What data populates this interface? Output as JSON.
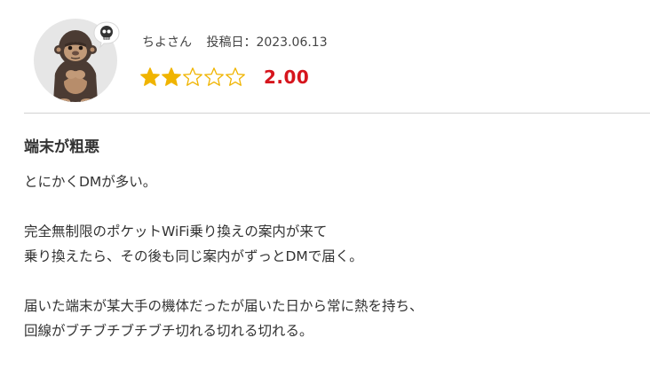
{
  "review": {
    "avatar_icon": "gorilla-avatar-icon",
    "badge_icon": "skull-badge-icon",
    "author": "ちよさん",
    "date_label": "投稿日：",
    "date": "2023.06.13",
    "rating": {
      "value": 2,
      "max": 5,
      "score_text": "2.00",
      "star_color": "#f0b400",
      "score_color": "#d6151d"
    },
    "title": "端末が粗悪",
    "paragraphs": [
      {
        "lines": [
          "とにかくDMが多い。"
        ]
      },
      {
        "lines": [
          "完全無制限のポケットWiFi乗り換えの案内が来て",
          "乗り換えたら、その後も同じ案内がずっとDMで届く。"
        ]
      },
      {
        "lines": [
          "届いた端末が某大手の機体だったが届いた日から常に熱を持ち、",
          "回線がブチブチブチブチ切れる切れる切れる。"
        ]
      }
    ]
  }
}
